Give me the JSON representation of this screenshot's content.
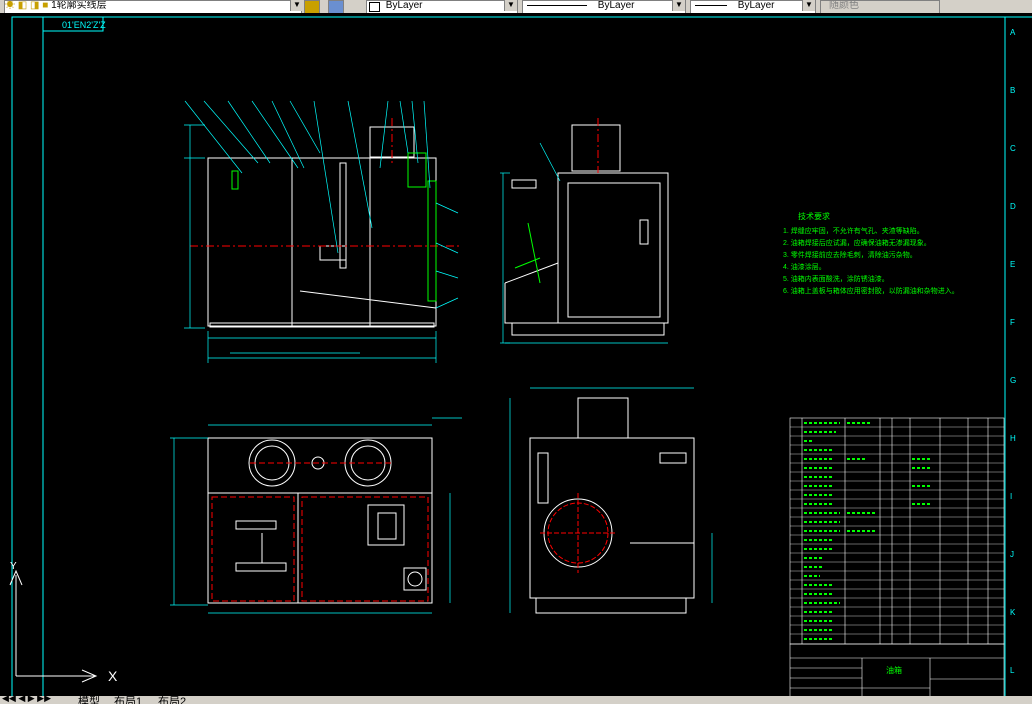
{
  "toolbar": {
    "layer_name": "1轮廓实线层",
    "color_value": "ByLayer",
    "linetype_value": "ByLayer",
    "lineweight_value": "ByLayer",
    "plotstyle_value": "随颜色"
  },
  "drawing": {
    "frame_label": "01'EN2'Z'Z",
    "tech_title": "技术要求",
    "tech_notes": [
      "1. 焊缝应牢固，不允许有气孔、夹渣等缺陷。",
      "2. 油箱焊接后应试漏，应确保油箱无渗漏现象。",
      "3. 零件焊接前应去除毛刺，清除油污杂物。",
      "4. 油漆涂层。",
      "5. 油箱内表面酸洗，涂防锈油漆。",
      "6. 油箱上盖板与箱体应用密封胶，以防漏油和杂物进入。"
    ],
    "zone_letters": [
      "A",
      "B",
      "C",
      "D",
      "E",
      "F",
      "G",
      "H",
      "I",
      "J",
      "K",
      "L"
    ],
    "title_block_name": "油箱",
    "ucs_x_label": "X",
    "ucs_y_label": "Y"
  },
  "status": {
    "tabs": [
      "模型",
      "布局1",
      "布局2"
    ]
  },
  "colors": {
    "frame": "#00ffff",
    "geometry": "#ffffff",
    "center_lines": "#ff0000",
    "dimensions": "#00ffff",
    "notes": "#00ff00",
    "background": "#000000"
  }
}
